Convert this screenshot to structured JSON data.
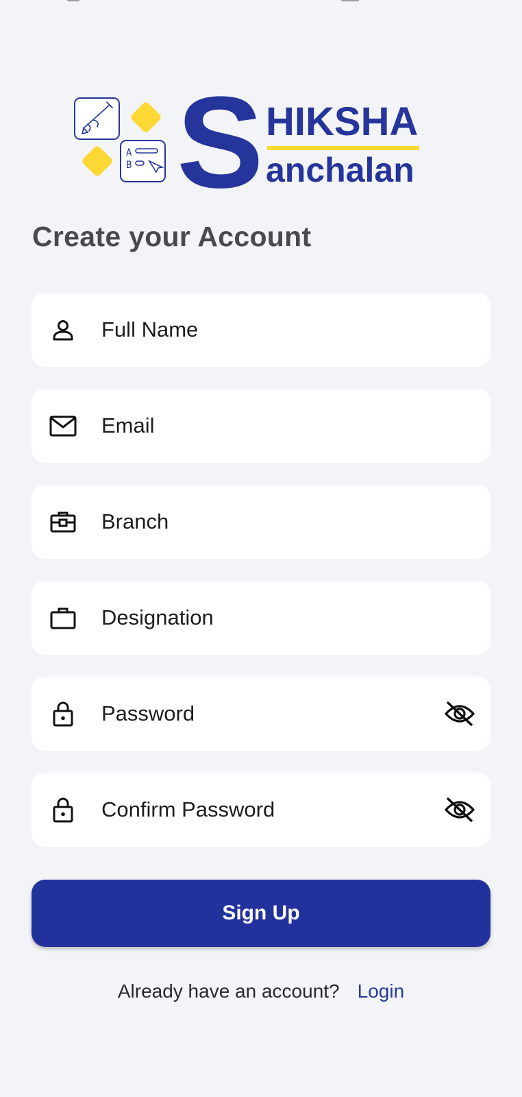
{
  "logo": {
    "big_letter": "S",
    "line1": "HIKSHA",
    "line2": "anchalan",
    "tile_text_1": "A",
    "tile_text_2": "B",
    "colors": {
      "brand_blue": "#25359b",
      "accent_yellow": "#fdd835"
    }
  },
  "form": {
    "heading": "Create your Account",
    "fields": [
      {
        "name": "full-name",
        "icon": "person-icon",
        "placeholder": "Full Name",
        "value": ""
      },
      {
        "name": "email",
        "icon": "mail-icon",
        "placeholder": "Email",
        "value": ""
      },
      {
        "name": "branch",
        "icon": "toolbox-icon",
        "placeholder": "Branch",
        "value": ""
      },
      {
        "name": "designation",
        "icon": "briefcase-icon",
        "placeholder": "Designation",
        "value": ""
      },
      {
        "name": "password",
        "icon": "lock-icon",
        "placeholder": "Password",
        "value": "",
        "toggle_icon": "eye-off-icon"
      },
      {
        "name": "confirm-password",
        "icon": "lock-icon",
        "placeholder": "Confirm Password",
        "value": "",
        "toggle_icon": "eye-off-icon"
      }
    ],
    "submit_label": "Sign Up"
  },
  "footer": {
    "question": "Already have an account?",
    "login_link": "Login"
  },
  "colors": {
    "background": "#f3f4f8",
    "field_background": "#ffffff",
    "button": "#22319c",
    "link": "#2a3a98"
  }
}
